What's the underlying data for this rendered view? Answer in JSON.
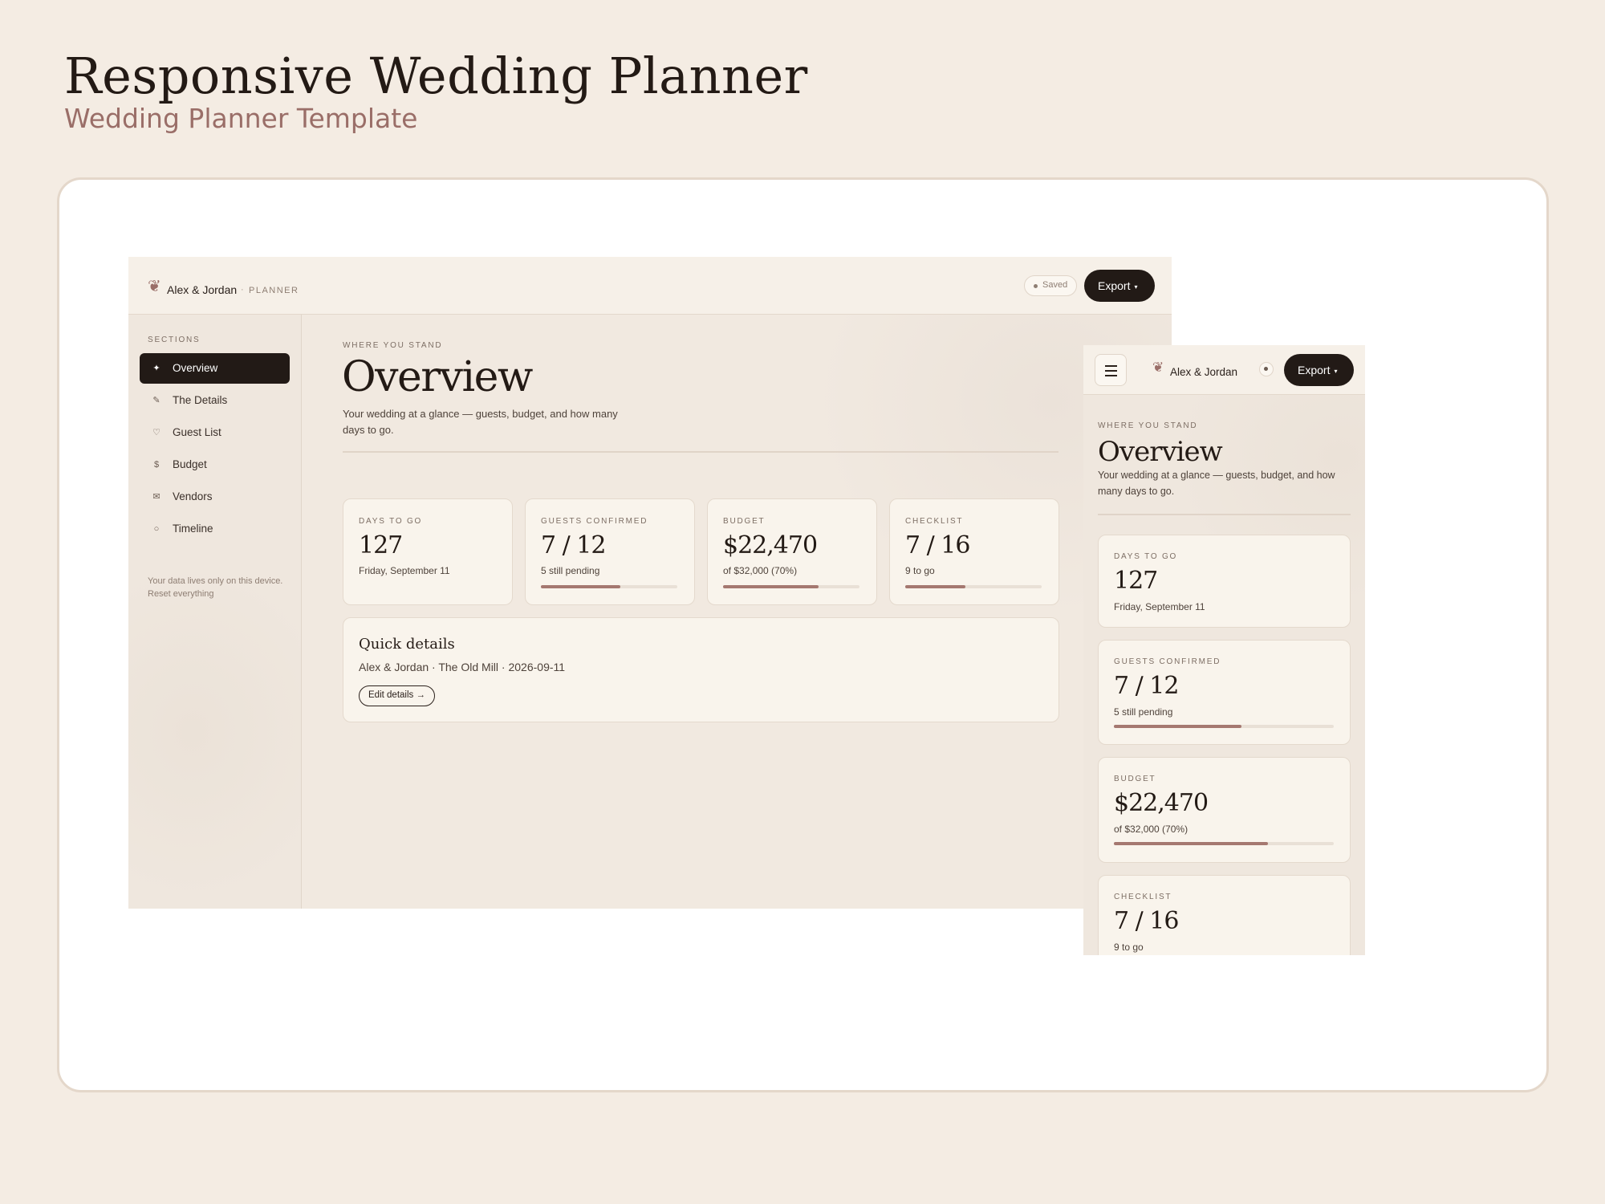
{
  "page": {
    "title": "Responsive Wedding Planner",
    "subtitle": "Wedding Planner Template"
  },
  "app": {
    "logo_glyph": "❦",
    "brand": "Alex & Jordan",
    "separator": "·",
    "app_name": "PLANNER",
    "saved_label": "Saved",
    "export_label": "Export",
    "export_caret": "▾"
  },
  "sidebar": {
    "heading": "SECTIONS",
    "items": [
      {
        "label": "Overview",
        "icon": "sparkle-icon",
        "glyph": "✦",
        "active": true
      },
      {
        "label": "The Details",
        "icon": "pen-icon",
        "glyph": "✎",
        "active": false
      },
      {
        "label": "Guest List",
        "icon": "heart-icon",
        "glyph": "♡",
        "active": false
      },
      {
        "label": "Budget",
        "icon": "dollar-icon",
        "glyph": "$",
        "active": false
      },
      {
        "label": "Vendors",
        "icon": "envelope-icon",
        "glyph": "✉",
        "active": false
      },
      {
        "label": "Timeline",
        "icon": "circle-icon",
        "glyph": "○",
        "active": false
      }
    ],
    "note_line1": "Your data lives only on this device.",
    "note_line2": "Reset everything"
  },
  "overview": {
    "eyebrow": "WHERE YOU STAND",
    "title": "Overview",
    "lead_desktop_line1": "Your wedding at a glance — guests, budget, and how many",
    "lead_desktop_line2": "days to go.",
    "lead_mobile_line1": "Your wedding at a glance — guests, budget, and how",
    "lead_mobile_line2": "many days to go."
  },
  "stats": [
    {
      "label": "DAYS TO GO",
      "value": "127",
      "sub": "Friday, September 11",
      "progress": null
    },
    {
      "label": "GUESTS CONFIRMED",
      "value": "7 / 12",
      "sub": "5 still pending",
      "progress": 0.58
    },
    {
      "label": "BUDGET",
      "value": "$22,470",
      "sub": "of $32,000 (70%)",
      "progress": 0.7
    },
    {
      "label": "CHECKLIST",
      "value": "7 / 16",
      "sub": "9 to go",
      "progress": 0.44
    }
  ],
  "quick_details": {
    "title": "Quick details",
    "meta": "Alex & Jordan · The Old Mill · 2026-09-11",
    "button": "Edit details →"
  },
  "colors": {
    "accent": "#a57870",
    "dark": "#221a16",
    "background": "#f4ece3"
  }
}
